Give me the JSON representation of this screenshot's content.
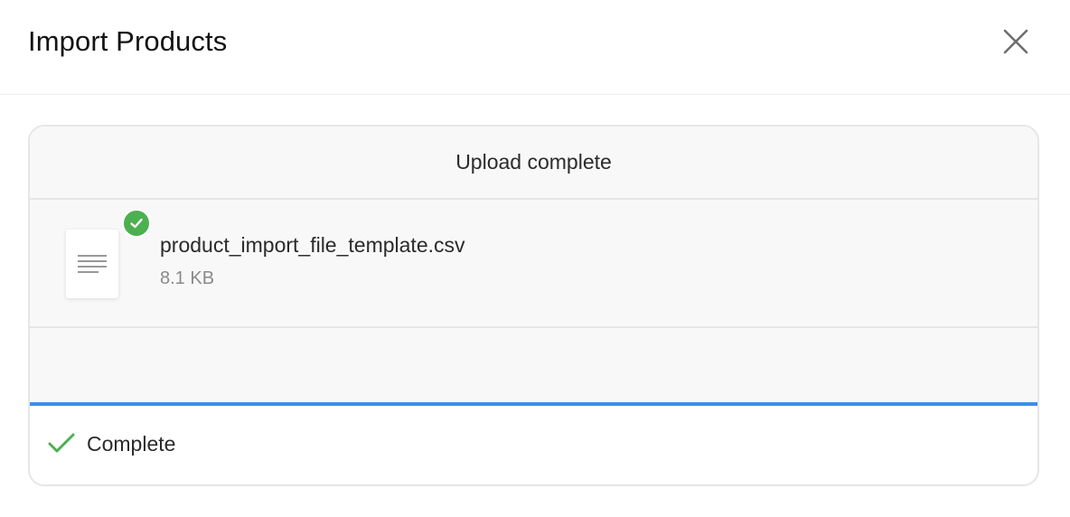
{
  "modal": {
    "title": "Import Products",
    "close_icon": "close-icon"
  },
  "upload": {
    "header": "Upload complete",
    "file": {
      "name": "product_import_file_template.csv",
      "size": "8.1 KB",
      "icon": "file-text-icon",
      "status_icon": "check-circle-icon"
    },
    "progress": 1.0,
    "status": {
      "label": "Complete",
      "icon": "checkmark-icon"
    }
  },
  "colors": {
    "success": "#4caf50",
    "progress": "#3d8ee8",
    "border": "#e6e6e6",
    "panel_bg": "#f8f8f8"
  }
}
